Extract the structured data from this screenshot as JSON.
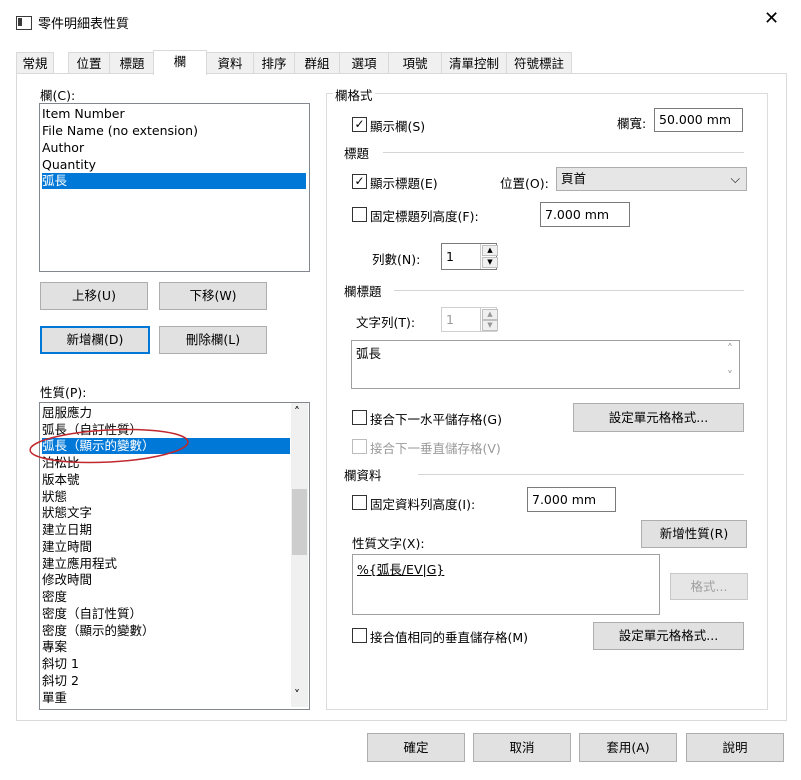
{
  "window": {
    "title": "零件明細表性質",
    "close": "✕"
  },
  "tabs": [
    "常規",
    "位置",
    "標題",
    "欄",
    "資料",
    "排序",
    "群組",
    "選項",
    "項號",
    "清單控制",
    "符號標註"
  ],
  "left": {
    "columns_label": "欄(C):",
    "columns": [
      "Item Number",
      "File Name (no extension)",
      "Author",
      "Quantity",
      "弧長"
    ],
    "selected_column": 4,
    "move_up": "上移(U)",
    "move_down": "下移(W)",
    "add_column": "新增欄(D)",
    "delete_column": "刪除欄(L)",
    "properties_label": "性質(P):",
    "properties": [
      "屈服應力",
      "弧長（自訂性質）",
      "弧長（顯示的變數）",
      "泊松比",
      "版本號",
      "狀態",
      "狀態文字",
      "建立日期",
      "建立時間",
      "建立應用程式",
      "修改時間",
      "密度",
      "密度（自訂性質）",
      "密度（顯示的變數）",
      "專案",
      "斜切 1",
      "斜切 2",
      "單重"
    ],
    "selected_property": 2
  },
  "right": {
    "column_format": "欄格式",
    "show_column": "顯示欄(S)",
    "width_label": "欄寬:",
    "width_value": "50.000 mm",
    "heading_section": "標題",
    "show_heading": "顯示標題(E)",
    "position_label": "位置(O):",
    "position_value": "頁首",
    "fixed_heading_height": "固定標題列高度(F):",
    "heading_height_value": "7.000 mm",
    "rows_label": "列數(N):",
    "rows_value": "1",
    "column_heading_section": "欄標題",
    "text_rows_label": "文字列(T):",
    "text_rows_value": "1",
    "heading_text": "弧長",
    "merge_horizontal": "接合下一水平儲存格(G)",
    "set_cell_format_1": "設定單元格格式...",
    "merge_vertical": "接合下一垂直儲存格(V)",
    "column_data_section": "欄資料",
    "fixed_data_height": "固定資料列高度(I):",
    "data_height_value": "7.000 mm",
    "property_text_label": "性質文字(X):",
    "add_property": "新增性質(R)",
    "property_text_value": "%{弧長/EV|G}",
    "format_button": "格式...",
    "merge_same_vertical": "接合值相同的垂直儲存格(M)",
    "set_cell_format_2": "設定單元格格式..."
  },
  "footer": {
    "ok": "確定",
    "cancel": "取消",
    "apply": "套用(A)",
    "help": "說明"
  },
  "icons": {
    "check": "✓",
    "caret_down": "⌵",
    "up": "▲",
    "down": "▼",
    "scroll_up": "˄",
    "scroll_down": "˅"
  },
  "colors": {
    "selection": "#0078d7",
    "annotation_circle": "#c0282e"
  }
}
